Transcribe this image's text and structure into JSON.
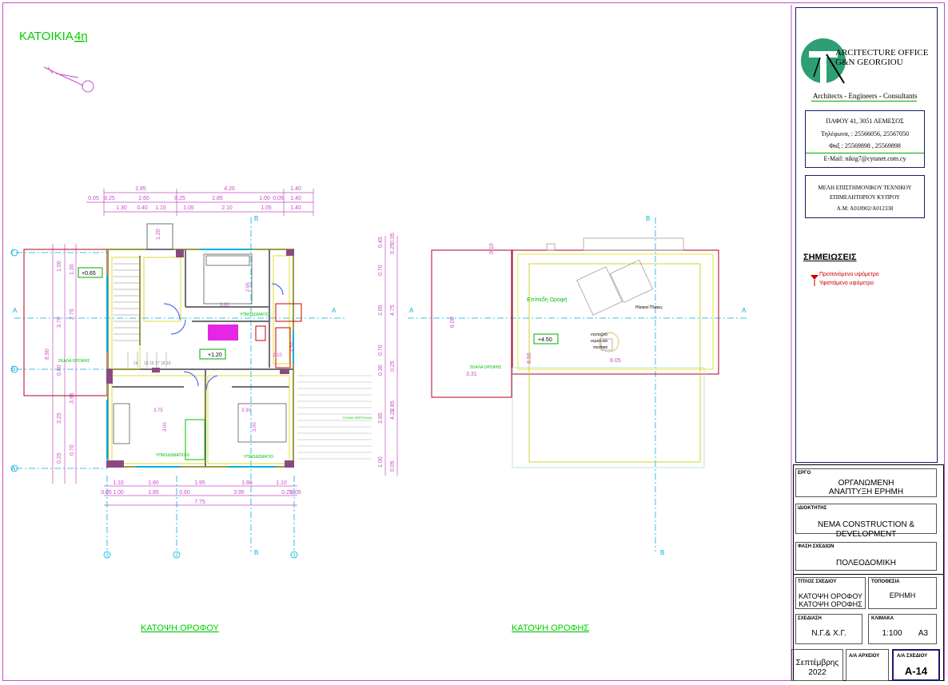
{
  "sheet": {
    "project_title": "ΚΑΤΟΙΚΙΑ",
    "project_number": "4η",
    "plan1_caption": "ΚΑΤΟΨΗ ΟΡΟΦΟΥ",
    "plan2_caption": "ΚΑΤΟΨΗ ΟΡΟΦΗΣ"
  },
  "office": {
    "name_line1": "ARCITECTURE OFFICE",
    "name_line2": "G&N GEORGIOU",
    "tagline": "Architects - Engineers - Consultants",
    "address": "ΠΑΦΟΥ 41, 3051 ΛΕΜΕΣΟΣ",
    "phone": "Τηλέφωνα, : 25566056, 25567050",
    "fax": "Φαξ : 25569898 , 25569898",
    "email": "E-Mail: nikig7@cytanet.com.cy",
    "member_line1": "ΜΕΛΗ ΕΠΙΣΤΗΜΟΝΙΚΟΥ ΤΕΧΝΙΚΟΥ",
    "member_line2": "ΕΠΙΜΕΛΗΤΗΡΙΟΥ ΚΥΠΡΟΥ",
    "member_line3": "Α.Μ: Α018902/Α012338"
  },
  "notes": {
    "heading": "ΣΗΜΕΙΩΣΕΙΣ",
    "item1": "Προτεινόμενο υψόμετρο",
    "item2": "Υφιστάμενο υψόμετρο"
  },
  "titleblock": {
    "project_label": "ΕΡΓΟ",
    "project_value1": "ΟΡΓΑΝΩΜΕΝΗ",
    "project_value2": "ΑΝΑΠΤΥΞΗ ΕΡΗΜΗ",
    "owner_label": "ΙΔΙΟΚΤΗΤΗΣ",
    "owner_value1": "NEMA CONSTRUCTION &",
    "owner_value2": "DEVELOPMENT",
    "phase_label": "ΦΑΣΗ ΣΧΕΔΙΩΝ",
    "phase_value": "ΠΟΛΕΟΔΟΜΙΚΗ",
    "drawing_title_label": "ΤΙΤΛΟΣ ΣΧΕΔΙΟΥ",
    "drawing_title_value1": "ΚΑΤΟΨΗ ΟΡΟΦΟΥ",
    "drawing_title_value2": "ΚΑΤΟΨΗ ΟΡΟΦΗΣ",
    "location_label": "ΤΟΠΟΘΕΣΙΑ",
    "location_value": "ΕΡΗΜΗ",
    "drawn_label": "ΣΧΕΔΙΑΣΗ",
    "drawn_value": "Ν.Γ.& Χ.Γ.",
    "scale_label": "ΚΛΙΜΑΚΑ",
    "scale_value": "1:100",
    "paper_value": "A3",
    "date_value1": "Σεπτέμβρης",
    "date_value2": "2022",
    "archive_label": "Α/Α ΑΡΧΕΙΟΥ",
    "sheet_no_label": "Α/Α ΣΧΕΔΙΟΥ",
    "sheet_no_value": "A-14"
  },
  "plan1": {
    "grid_letters": [
      "Γ",
      "Β",
      "Α"
    ],
    "grid_numbers": [
      "3",
      "2",
      "1"
    ],
    "grid_b": "B",
    "section_a": "A",
    "top_dims_row1": [
      "2.85",
      "4.20",
      "1.40"
    ],
    "top_dims_row2": [
      "0.05",
      "0.25",
      "2.60",
      "0.25",
      "2.85",
      "1.00",
      "0.05",
      "1.40"
    ],
    "top_dims_row3": [
      "1.30",
      "0.40",
      "1.15",
      "1.05",
      "2.10",
      "1.05",
      "1.40"
    ],
    "bottom_dims_row1": [
      "1.10",
      "1.80",
      "1.95",
      "1.80",
      "1.10"
    ],
    "bottom_dims_row2": [
      "0.05",
      "1.00",
      "1.85",
      "0.60",
      "3.95",
      "0.25",
      "0.05"
    ],
    "bottom_total": "7.75",
    "left_dims": [
      "1.00",
      "3.70",
      "0.60",
      "3.25",
      "0.25",
      "8.90"
    ],
    "left_dims2": [
      "1.30",
      "2.75",
      "3.95",
      "0.70",
      "0.05"
    ],
    "level1": "+0.65",
    "level2": "+1.20",
    "roof_stair_label": "ΣΚΑΛΑ ΟΡΟΦΗΣ",
    "bedroom_labels": [
      "ΥΠΝΟΔΩΜΑΤΙΟ",
      "ΥΠΝΟΔΩΜΑΤΙΟ-3-",
      "ΥΠΝΟΔΩΜΑΤΙΟ"
    ],
    "room_dims": [
      "3.60",
      "3.75",
      "3.30",
      "3.00",
      "3.00",
      "2.10",
      "1.70",
      "2.95"
    ],
    "window_label": "1.20",
    "stair_numbers": [
      "14",
      "15",
      "16",
      "17",
      "18",
      "19"
    ],
    "pergola_label": "ΞΥΛΙΝΗ ΠΕΡΓΚΟΛΑ"
  },
  "plan2": {
    "grid_b": "B",
    "section_a": "A",
    "right_dims": [
      "0.05",
      "0.45",
      "0.25",
      "0.70",
      "2.65",
      "4.75",
      "0.70",
      "0.30",
      "0.25",
      "3.85",
      "2.85",
      "4.20",
      "0.05",
      "1.00"
    ],
    "inner_dims": [
      "6.00",
      "8.50",
      "8.05",
      "3.31",
      "0.10"
    ],
    "level": "+4.50",
    "flat_roof": "Επίπεδη Οροφή",
    "panels": "Ηλιακοί Πλάκες",
    "water_tank1": "ντεπόζιτο",
    "water_tank2": "νερού και",
    "water_tank3": "πιεστικό",
    "roof_stair_label": "ΣΚΑΛΑ ΟΡΟΦΗΣ"
  }
}
